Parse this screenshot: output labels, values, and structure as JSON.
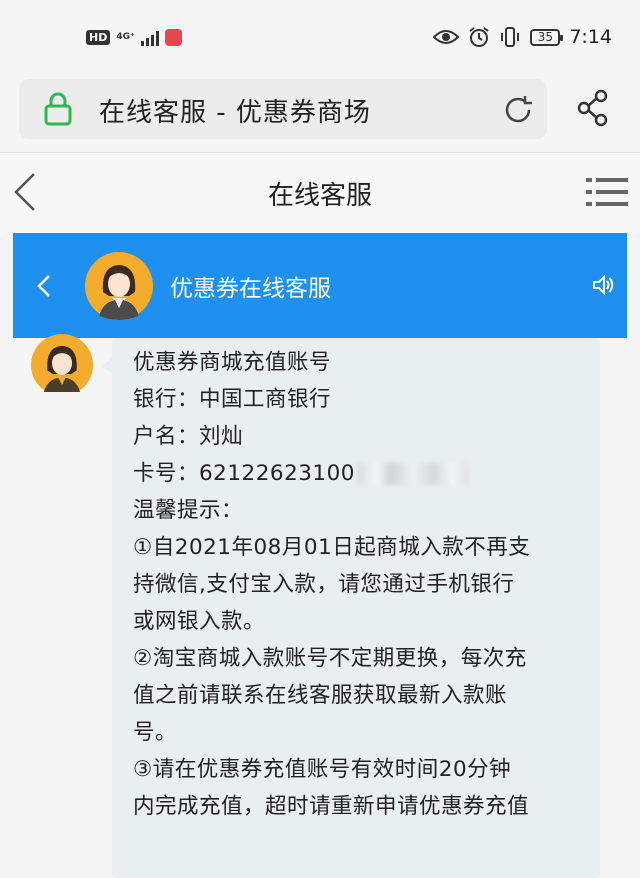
{
  "status_bar": {
    "hd_label": "HD",
    "network_label": "4G⁺",
    "battery_level": "35",
    "time": "7:14"
  },
  "browser": {
    "title": "在线客服 - 优惠券商场"
  },
  "nav": {
    "title": "在线客服"
  },
  "chat": {
    "agent_name": "优惠券在线客服",
    "message": {
      "heading": "优惠券商城充值账号",
      "bank_line": "银行：中国工商银行",
      "holder_line": "户名：刘灿",
      "card_line": "卡号：62122623100",
      "tips_label": "温馨提示：",
      "tip_lines": [
        "①自2021年08月01日起商城入款不再支",
        "持微信,支付宝入款，请您通过手机银行",
        "或网银入款。",
        "②淘宝商城入款账号不定期更换，每次充",
        "值之前请联系在线客服获取最新入款账",
        "号。",
        "③请在优惠券充值账号有效时间20分钟",
        "内完成充值，超时请重新申请优惠券充值"
      ]
    }
  },
  "colors": {
    "accent": "#1e90f0",
    "lock_green": "#2db84b",
    "bubble": "#e9eef0"
  }
}
